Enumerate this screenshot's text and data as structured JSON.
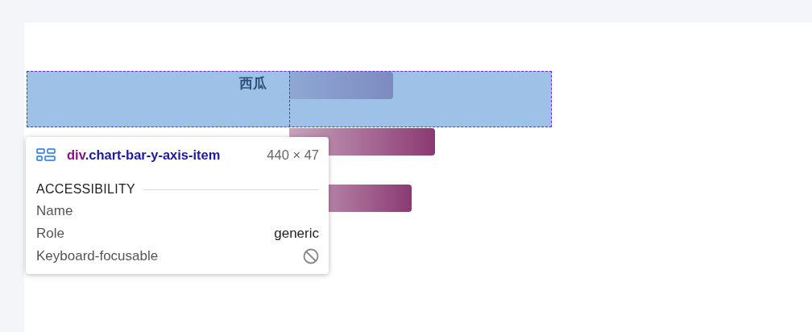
{
  "chart": {
    "labels": [
      "西瓜"
    ]
  },
  "inspector": {
    "tag": "div",
    "class_name": ".chart-bar-y-axis-item",
    "size": "440 × 47",
    "section": "ACCESSIBILITY",
    "properties": [
      {
        "name": "Name",
        "kind": "text"
      },
      {
        "name": "Role",
        "kind": "text",
        "value": "generic"
      },
      {
        "name": "Keyboard-focusable",
        "kind": "icon"
      }
    ]
  }
}
